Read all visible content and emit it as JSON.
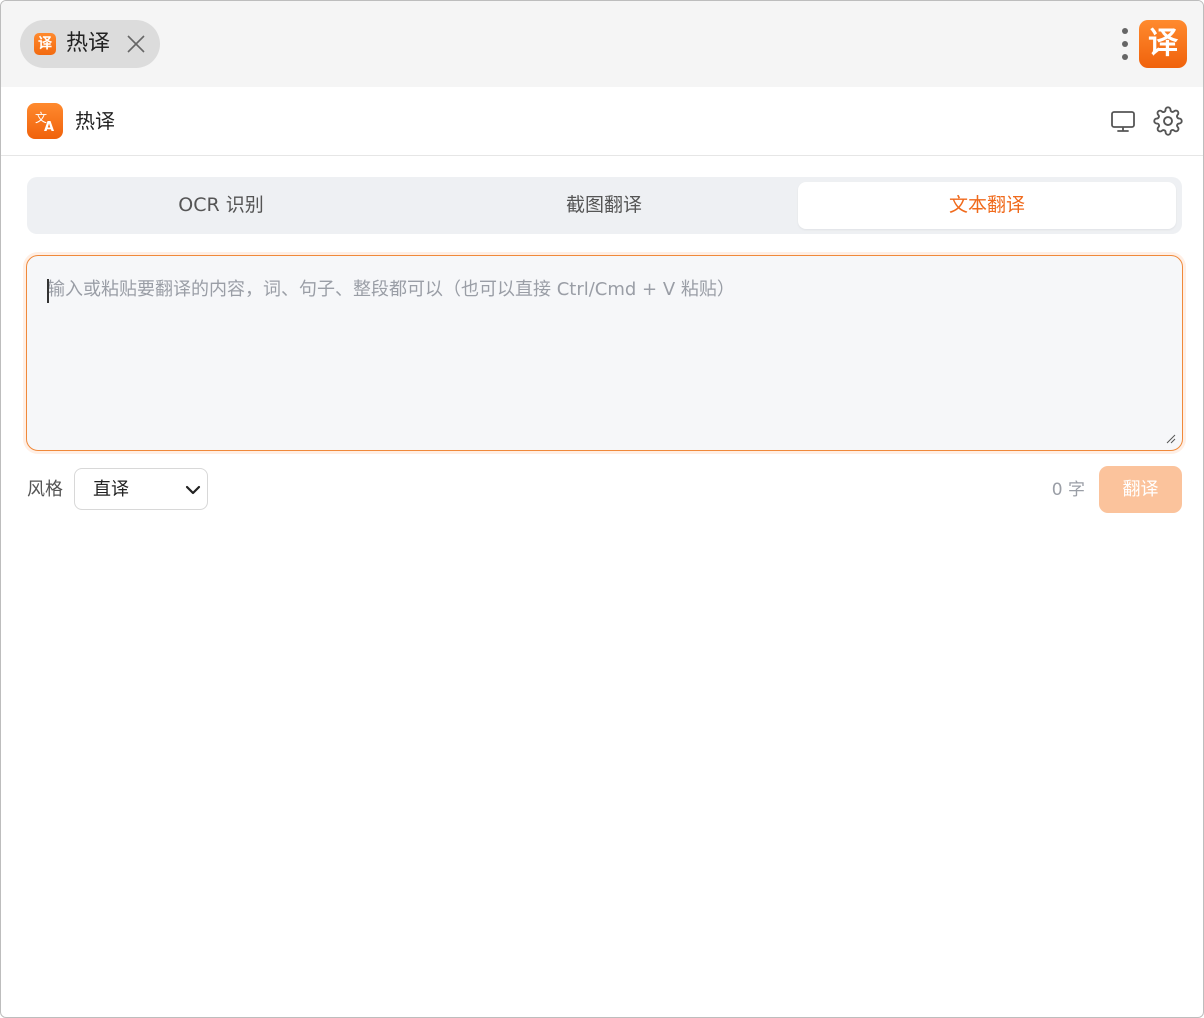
{
  "chrome": {
    "tab_logo_char": "译",
    "tab_label": "热译",
    "app_badge_char": "译"
  },
  "header": {
    "title": "热译"
  },
  "modes": [
    {
      "label": "OCR 识别",
      "active": false
    },
    {
      "label": "截图翻译",
      "active": false
    },
    {
      "label": "文本翻译",
      "active": true
    }
  ],
  "input": {
    "placeholder": "输入或粘贴要翻译的内容，词、句子、整段都可以（也可以直接 Ctrl/Cmd + V 粘贴）",
    "value": ""
  },
  "style": {
    "label": "风格",
    "selected": "直译"
  },
  "counter": "0 字",
  "translate_button": "翻译",
  "colors": {
    "accent": "#f06a1c",
    "button_disabled": "#fbc39c",
    "input_bg": "#f6f7f9"
  }
}
